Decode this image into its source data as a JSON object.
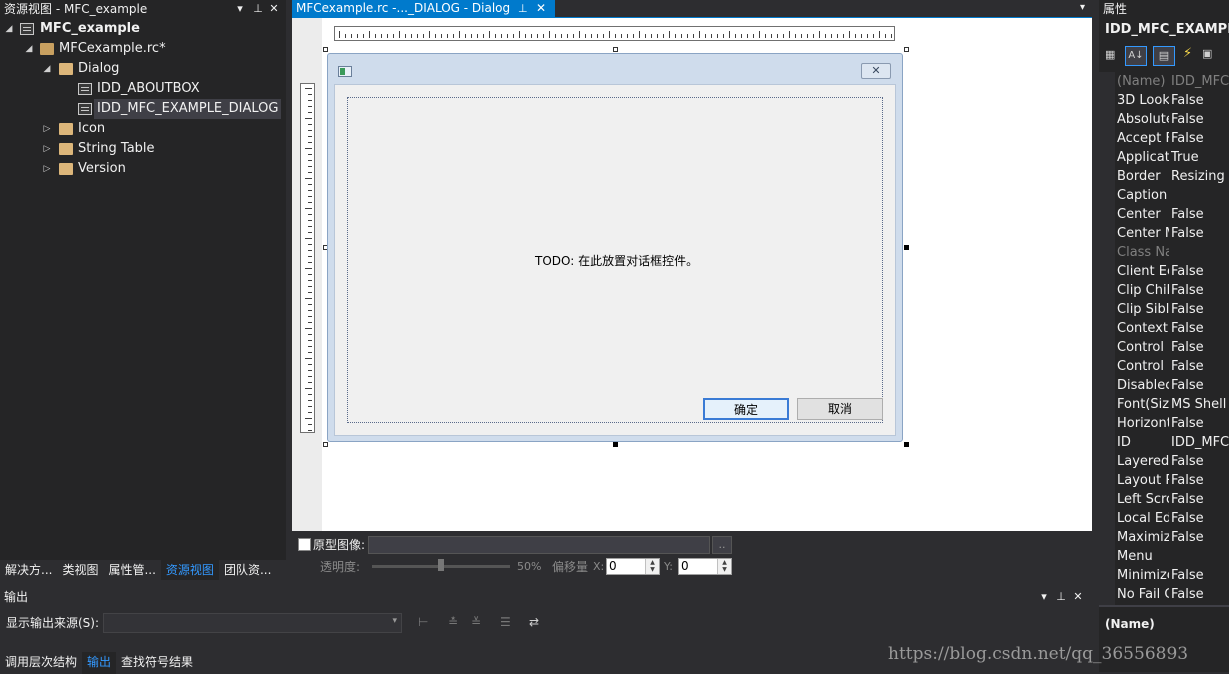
{
  "left_panel": {
    "title": "资源视图 - MFC_example",
    "tree": {
      "project": "MFC_example",
      "rc_file": "MFCexample.rc*",
      "dialog_folder": "Dialog",
      "dialog_items": [
        "IDD_ABOUTBOX",
        "IDD_MFC_EXAMPLE_DIALOG"
      ],
      "icon_folder": "Icon",
      "string_table_folder": "String Table",
      "version_folder": "Version"
    },
    "bottom_tabs": [
      "解决方...",
      "类视图",
      "属性管...",
      "资源视图",
      "团队资..."
    ],
    "active_tab": "资源视图"
  },
  "editor": {
    "tab_label": "MFCexample.rc -..._DIALOG - Dialog",
    "dialog": {
      "todo_text": "TODO: 在此放置对话框控件。",
      "ok_button": "确定",
      "cancel_button": "取消"
    },
    "bottom_bar": {
      "prototype_label": "原型图像:",
      "browse_button": "..",
      "transparency_label": "透明度:",
      "transparency_value": "50%",
      "offset_label": "偏移量",
      "x_label": "X:",
      "x_value": "0",
      "y_label": "Y:",
      "y_value": "0"
    }
  },
  "properties": {
    "title": "属性",
    "object_name": "IDD_MFC_EXAMPLE_",
    "rows": [
      {
        "name": "(Name)",
        "value": "IDD_MFC_",
        "dim": true
      },
      {
        "name": "3D Look",
        "value": "False",
        "dim": false
      },
      {
        "name": "Absolute",
        "value": "False",
        "dim": false
      },
      {
        "name": "Accept F",
        "value": "False",
        "dim": false
      },
      {
        "name": "Applicat",
        "value": "True",
        "dim": false
      },
      {
        "name": "Border",
        "value": "Resizing",
        "dim": false
      },
      {
        "name": "Caption",
        "value": "",
        "dim": false
      },
      {
        "name": "Center",
        "value": "False",
        "dim": false
      },
      {
        "name": "Center M",
        "value": "False",
        "dim": false
      },
      {
        "name": "Class Na",
        "value": "",
        "dim": true
      },
      {
        "name": "Client Ec",
        "value": "False",
        "dim": false
      },
      {
        "name": "Clip Chil",
        "value": "False",
        "dim": false
      },
      {
        "name": "Clip Sibl",
        "value": "False",
        "dim": false
      },
      {
        "name": "Context",
        "value": "False",
        "dim": false
      },
      {
        "name": "Control",
        "value": "False",
        "dim": false
      },
      {
        "name": "Control",
        "value": "False",
        "dim": false
      },
      {
        "name": "Disablec",
        "value": "False",
        "dim": false
      },
      {
        "name": "Font(Size",
        "value": "MS Shell",
        "dim": false
      },
      {
        "name": "Horizont",
        "value": "False",
        "dim": false
      },
      {
        "name": "ID",
        "value": "IDD_MFC_",
        "dim": false
      },
      {
        "name": "Layered",
        "value": "False",
        "dim": false
      },
      {
        "name": "Layout R",
        "value": "False",
        "dim": false
      },
      {
        "name": "Left Scro",
        "value": "False",
        "dim": false
      },
      {
        "name": "Local Ed",
        "value": "False",
        "dim": false
      },
      {
        "name": "Maximiz",
        "value": "False",
        "dim": false
      },
      {
        "name": "Menu",
        "value": "",
        "dim": false
      },
      {
        "name": "Minimize",
        "value": "False",
        "dim": false
      },
      {
        "name": "No Fail C",
        "value": "False",
        "dim": false
      }
    ],
    "description_name": "(Name)"
  },
  "output": {
    "title": "输出",
    "source_label": "显示输出来源(S):",
    "source_value": ""
  },
  "output_tabs": [
    "调用层次结构",
    "输出",
    "查找符号结果"
  ],
  "active_output_tab": "输出",
  "watermark": "https://blog.csdn.net/qq_36556893"
}
